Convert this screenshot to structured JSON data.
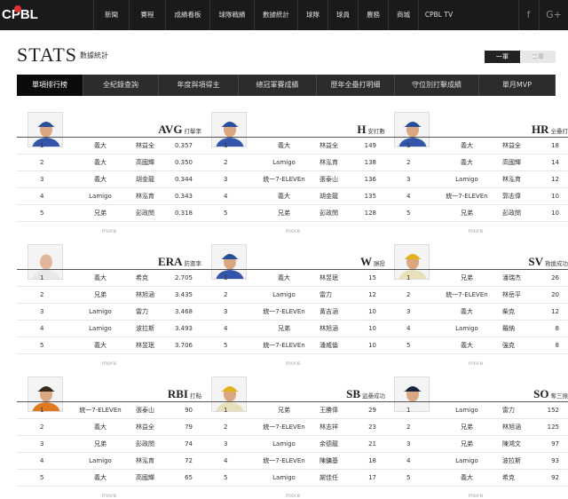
{
  "site": {
    "logo": "CPBL"
  },
  "nav": [
    "新聞",
    "賽程",
    "成績看板",
    "球隊戰績",
    "數據統計",
    "球隊",
    "球員",
    "農務",
    "商城",
    "CPBL TV"
  ],
  "social": [
    "f",
    "G+"
  ],
  "page": {
    "title": "STATS",
    "subtitle": "數據統計",
    "toggle_on": "一軍",
    "toggle_off": "二軍"
  },
  "tabs": [
    "單項排行榜",
    "全紀錄查詢",
    "年度與項得主",
    "總冠軍賽成績",
    "歷年全壘打明細",
    "守位別打擊成績",
    "單月MVP"
  ],
  "colors": {
    "accent_red": "#c62828",
    "nav_bg": "#1a1a1a",
    "tab_bg": "#2c2c2c"
  },
  "cards": [
    {
      "stat": "AVG",
      "zh": "打擊率",
      "more": "more",
      "photo": "player-blue-cap",
      "rows": [
        [
          "1",
          "義大",
          "林益全",
          "0.357"
        ],
        [
          "2",
          "義大",
          "高國輝",
          "0.350"
        ],
        [
          "3",
          "義大",
          "胡金龍",
          "0.344"
        ],
        [
          "4",
          "Lamigo",
          "林泓育",
          "0.343"
        ],
        [
          "5",
          "兄弟",
          "彭政閔",
          "0.318"
        ]
      ]
    },
    {
      "stat": "H",
      "zh": "安打數",
      "more": "more",
      "photo": "player-blue-cap",
      "rows": [
        [
          "1",
          "義大",
          "林益全",
          "149"
        ],
        [
          "2",
          "Lamigo",
          "林泓育",
          "138"
        ],
        [
          "3",
          "統一7-ELEVEn",
          "張泰山",
          "136"
        ],
        [
          "4",
          "義大",
          "胡金龍",
          "135"
        ],
        [
          "5",
          "兄弟",
          "彭政閔",
          "128"
        ]
      ]
    },
    {
      "stat": "HR",
      "zh": "全壘打",
      "more": "more",
      "photo": "player-blue-cap",
      "rows": [
        [
          "1",
          "義大",
          "林益全",
          "18"
        ],
        [
          "2",
          "義大",
          "高國輝",
          "14"
        ],
        [
          "3",
          "Lamigo",
          "林泓育",
          "12"
        ],
        [
          "4",
          "統一7-ELEVEn",
          "郭志偉",
          "10"
        ],
        [
          "5",
          "兄弟",
          "彭政閔",
          "10"
        ]
      ]
    },
    {
      "stat": "ERA",
      "zh": "防禦率",
      "more": "more",
      "photo": "player-bald",
      "rows": [
        [
          "1",
          "義大",
          "希克",
          "2.705"
        ],
        [
          "2",
          "兄弟",
          "林旭涵",
          "3.435"
        ],
        [
          "3",
          "Lamigo",
          "雷力",
          "3.468"
        ],
        [
          "4",
          "Lamigo",
          "波拉斯",
          "3.493"
        ],
        [
          "5",
          "義大",
          "林昱珉",
          "3.706"
        ]
      ]
    },
    {
      "stat": "W",
      "zh": "勝投",
      "more": "more",
      "photo": "player-blue-cap",
      "rows": [
        [
          "1",
          "義大",
          "林昱珉",
          "15"
        ],
        [
          "2",
          "Lamigo",
          "雷力",
          "12"
        ],
        [
          "3",
          "統一7-ELEVEn",
          "黃吉涵",
          "10"
        ],
        [
          "4",
          "兄弟",
          "林旭涵",
          "10"
        ],
        [
          "5",
          "統一7-ELEVEn",
          "潘威倫",
          "10"
        ]
      ]
    },
    {
      "stat": "SV",
      "zh": "救援成功",
      "more": "more",
      "photo": "player-yellow-cap",
      "rows": [
        [
          "1",
          "兄弟",
          "潘瑞杰",
          "26"
        ],
        [
          "2",
          "統一7-ELEVEn",
          "林岳平",
          "20"
        ],
        [
          "3",
          "義大",
          "柴克",
          "12"
        ],
        [
          "4",
          "Lamigo",
          "羅納",
          "8"
        ],
        [
          "5",
          "義大",
          "強克",
          "8"
        ]
      ]
    },
    {
      "stat": "RBI",
      "zh": "打點",
      "more": "more",
      "photo": "player-orange",
      "rows": [
        [
          "1",
          "統一7-ELEVEn",
          "張泰山",
          "90"
        ],
        [
          "2",
          "義大",
          "林益全",
          "79"
        ],
        [
          "3",
          "兄弟",
          "彭政閔",
          "74"
        ],
        [
          "4",
          "Lamigo",
          "林泓育",
          "72"
        ],
        [
          "5",
          "義大",
          "高國輝",
          "65"
        ]
      ]
    },
    {
      "stat": "SB",
      "zh": "盜壘成功",
      "more": "more",
      "photo": "player-yellow-cap",
      "rows": [
        [
          "1",
          "兄弟",
          "王勝偉",
          "29"
        ],
        [
          "2",
          "統一7-ELEVEn",
          "林志祥",
          "23"
        ],
        [
          "3",
          "Lamigo",
          "余德龍",
          "21"
        ],
        [
          "4",
          "統一7-ELEVEn",
          "陳鏞基",
          "18"
        ],
        [
          "5",
          "Lamigo",
          "謝佳任",
          "17"
        ]
      ]
    },
    {
      "stat": "SO",
      "zh": "奪三振",
      "more": "more",
      "photo": "player-navy-cap",
      "rows": [
        [
          "1",
          "Lamigo",
          "雷力",
          "152"
        ],
        [
          "2",
          "兄弟",
          "林旭涵",
          "125"
        ],
        [
          "3",
          "兄弟",
          "陳鴻文",
          "97"
        ],
        [
          "4",
          "Lamigo",
          "波拉斯",
          "93"
        ],
        [
          "5",
          "義大",
          "希克",
          "92"
        ]
      ]
    }
  ]
}
